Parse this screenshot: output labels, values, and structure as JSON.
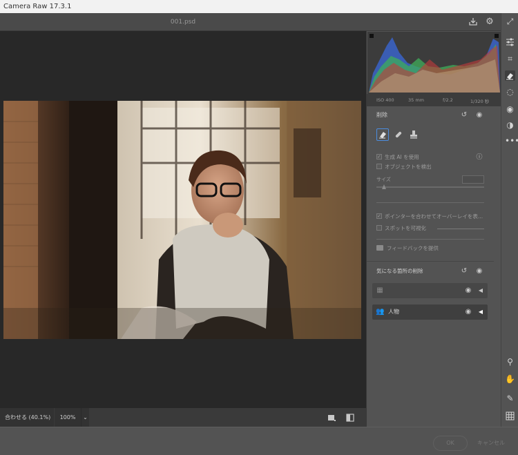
{
  "app": {
    "title": "Camera Raw 17.3.1",
    "filename": "001.psd"
  },
  "exif": {
    "iso": "ISO 400",
    "focal": "35 mm",
    "aperture": "f/2.2",
    "shutter": "1/320 秒"
  },
  "remove_panel": {
    "title": "削除",
    "use_generative_ai": "生成 AI を使用",
    "detect_objects": "オブジェクトを検出",
    "size_label": "サイズ",
    "overlay_on_hover": "ポインターを合わせてオーバーレイを表...",
    "visualize_spots": "スポットを可視化",
    "feedback": "フィードバックを提供"
  },
  "distractions": {
    "title": "気になる箇所の削除",
    "rows": [
      {
        "label": ""
      },
      {
        "label": "人物"
      }
    ]
  },
  "statusbar": {
    "fit": "合わせる (40.1%)",
    "zoom": "100%",
    "zoom_caret": "⌄"
  },
  "footer": {
    "ok": "OK",
    "cancel": "キャンセル"
  },
  "icons": {
    "save": "save-icon",
    "settings": "gear-icon",
    "expand": "expand-icon",
    "edit": "sliders-icon",
    "crop": "crop-icon",
    "remove": "eraser-icon",
    "masking": "masking-icon",
    "redeye": "eye-icon",
    "presets": "presets-icon",
    "more": "more-icon",
    "zoom": "zoom-icon",
    "hand": "hand-icon",
    "sampler": "color-sampler-icon",
    "grid": "grid-icon"
  }
}
